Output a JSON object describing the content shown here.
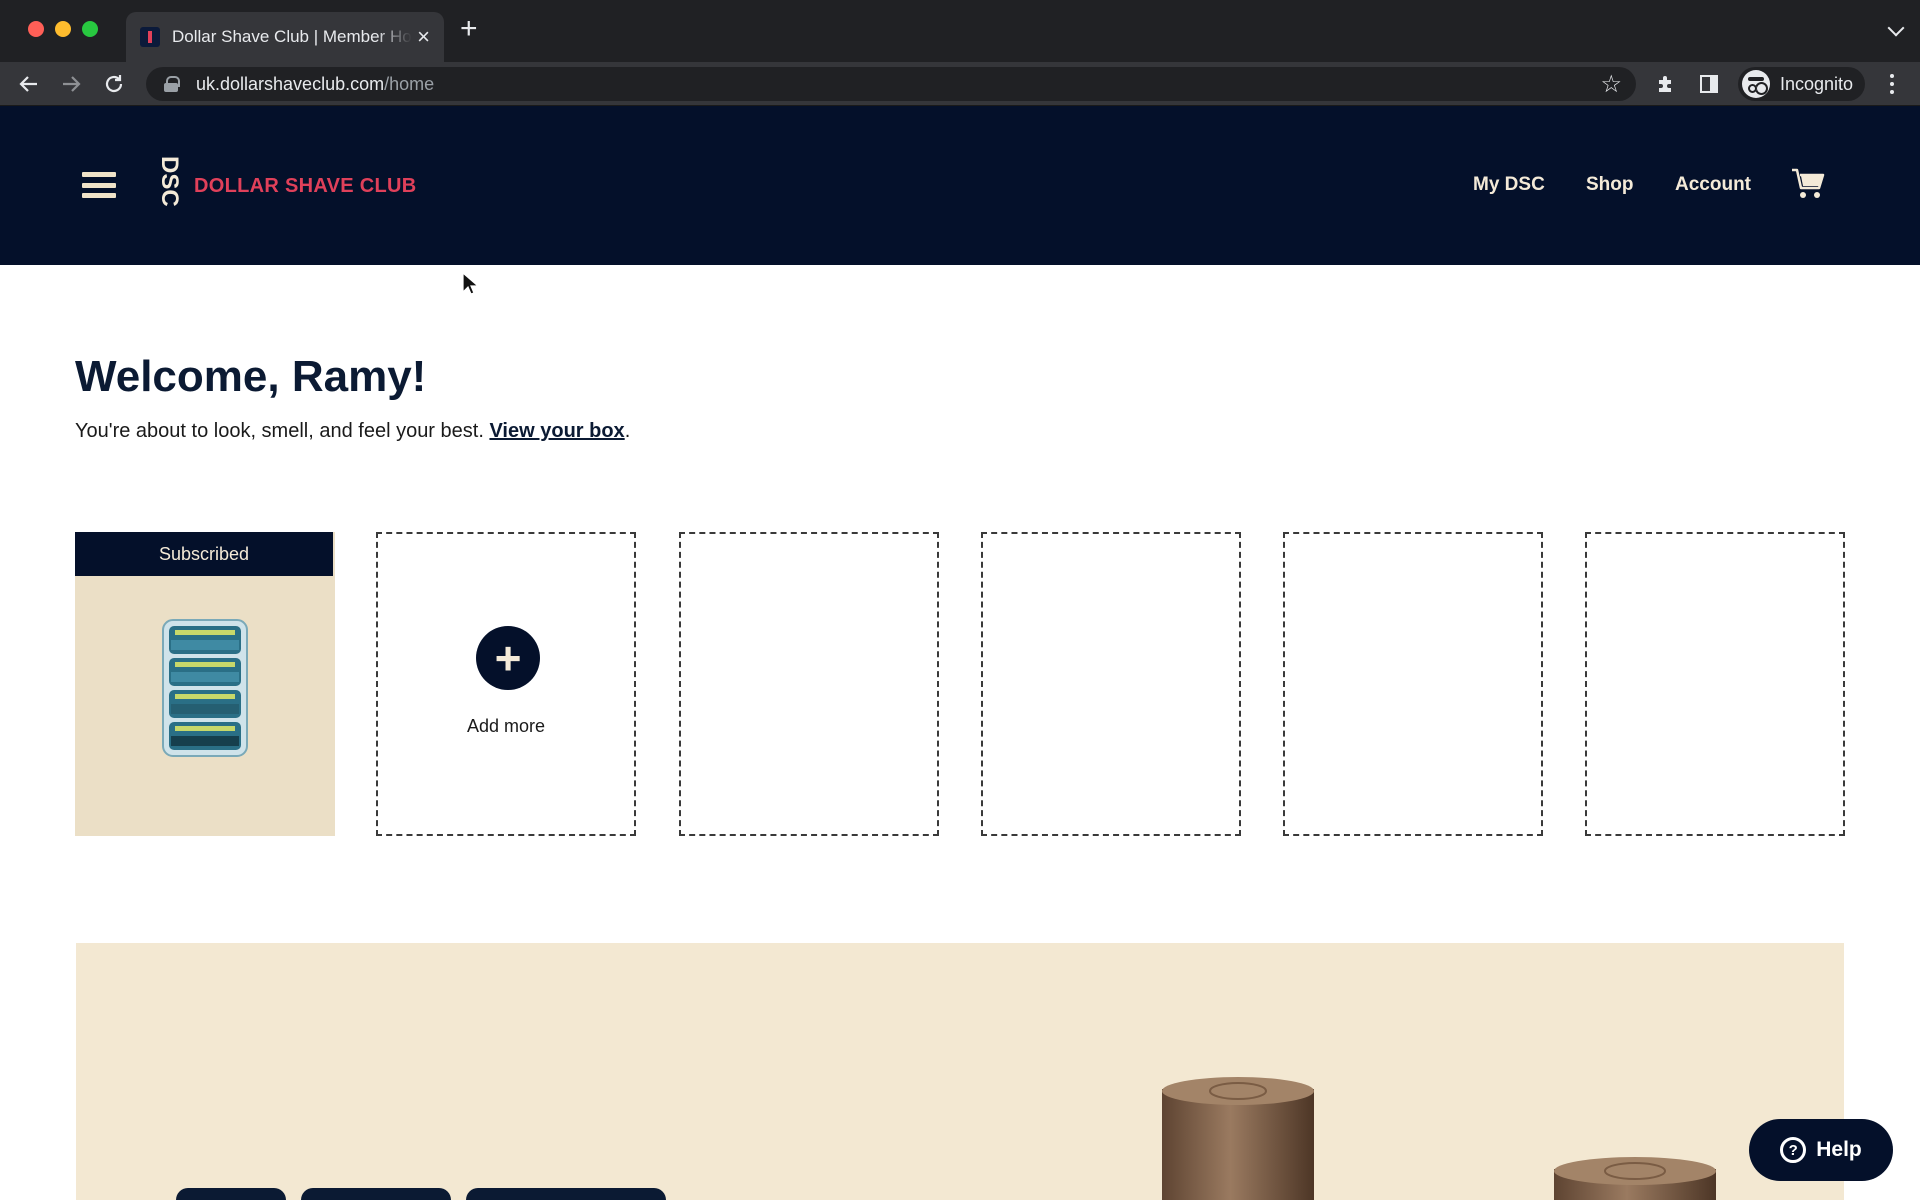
{
  "browser": {
    "tab_title": "Dollar Shave Club | Member Home",
    "url_host": "uk.dollarshaveclub.com",
    "url_path": "/home",
    "profile_label": "Incognito"
  },
  "header": {
    "brand": "DOLLAR SHAVE CLUB",
    "logo_mark": "DSC",
    "nav": {
      "my_dsc": "My DSC",
      "shop": "Shop",
      "account": "Account"
    }
  },
  "main": {
    "welcome": "Welcome, Ramy!",
    "subtitle": "You're about to look, smell, and feel your best. ",
    "view_box_link": "View your box",
    "subtitle_end": ".",
    "subscribed_label": "Subscribed",
    "add_more_label": "Add more"
  },
  "help": {
    "label": "Help"
  },
  "colors": {
    "header_bg": "#04102a",
    "brand_red": "#e0405a",
    "cream": "#f4ead8",
    "product_tile_bg": "#ebdfc6"
  }
}
